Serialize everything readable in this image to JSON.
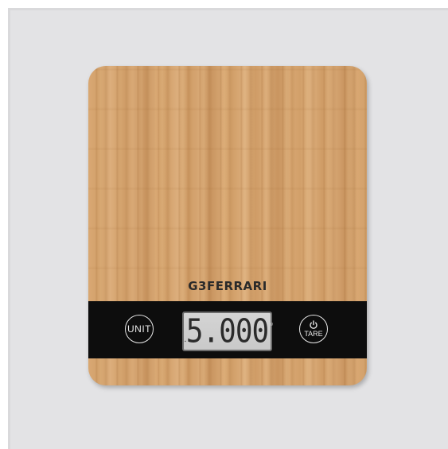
{
  "product": {
    "brand": "G3FERRARI",
    "display": {
      "reading": "5.000"
    },
    "buttons": {
      "unit_label": "UNIT",
      "tare_label": "TARE"
    },
    "icons": {
      "power": "power-icon"
    }
  },
  "colors": {
    "background": "#e3e3e5",
    "bamboo": "#d4a46f",
    "band": "#0d0d0d",
    "lcd": "#cfcfcf"
  }
}
